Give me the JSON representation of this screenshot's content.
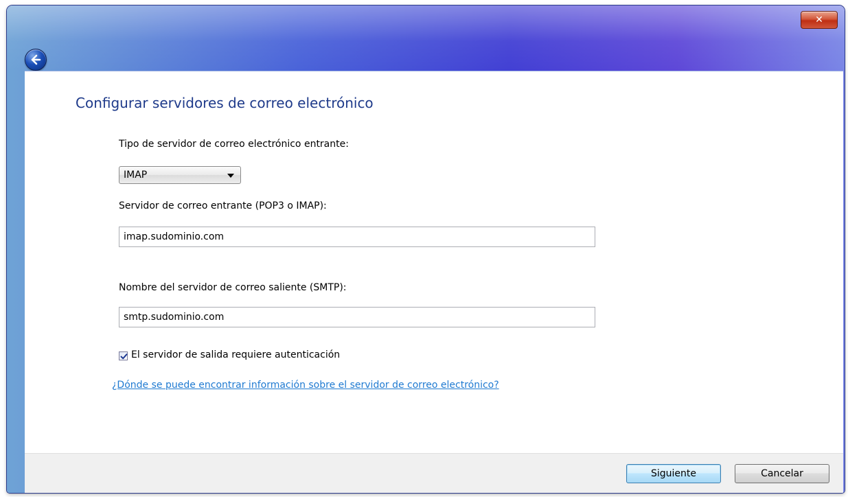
{
  "window": {
    "close_label": "✕"
  },
  "content": {
    "title": "Configurar servidores de correo electrónico",
    "incoming_type_label": "Tipo de servidor de correo electrónico entrante:",
    "incoming_type_value": "IMAP",
    "incoming_server_label": "Servidor de correo entrante (POP3 o IMAP):",
    "incoming_server_value": "imap.sudominio.com",
    "outgoing_server_label": "Nombre del servidor de correo saliente (SMTP):",
    "outgoing_server_value": "smtp.sudominio.com",
    "auth_checkbox_label": "El servidor de salida requiere autenticación",
    "auth_checked": true,
    "help_link": "¿Dónde se puede encontrar información sobre el servidor de correo electrónico?"
  },
  "footer": {
    "next_label": "Siguiente",
    "cancel_label": "Cancelar"
  }
}
